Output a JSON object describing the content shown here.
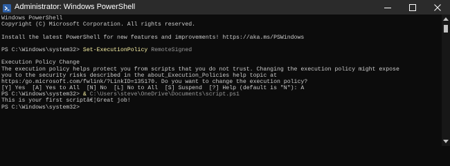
{
  "titlebar": {
    "title": "Administrator: Windows PowerShell",
    "app_icon": "powershell-icon",
    "controls": {
      "minimize_icon": "minimize-icon",
      "maximize_icon": "maximize-icon",
      "close_icon": "close-icon"
    }
  },
  "colors": {
    "background": "#0c0c0c",
    "text": "#cccccc",
    "command": "#f9f1a5",
    "parameter": "#9a9a9a",
    "titlebar": "#2b2b2b"
  },
  "terminal": {
    "lines": [
      {
        "text": "Windows PowerShell"
      },
      {
        "text": "Copyright (C) Microsoft Corporation. All rights reserved."
      },
      {
        "text": ""
      },
      {
        "text": "Install the latest PowerShell for new features and improvements! https://aka.ms/PSWindows"
      },
      {
        "text": ""
      },
      {
        "prompt": "PS C:\\Windows\\system32> ",
        "command": "Set-ExecutionPolicy",
        "argument": " RemoteSigned"
      },
      {
        "text": ""
      },
      {
        "text": "Execution Policy Change"
      },
      {
        "text": "The execution policy helps protect you from scripts that you do not trust. Changing the execution policy might expose"
      },
      {
        "text": "you to the security risks described in the about_Execution_Policies help topic at"
      },
      {
        "text": "https:/go.microsoft.com/fwlink/?LinkID=135170. Do you want to change the execution policy?"
      },
      {
        "text": "[Y] Yes  [A] Yes to All  [N] No  [L] No to All  [S] Suspend  [?] Help (default is \"N\"): A"
      },
      {
        "prompt": "PS C:\\Windows\\system32> ",
        "command": "&",
        "argument": " C:\\Users\\steve\\OneDrive\\Documents\\script.ps1"
      },
      {
        "text": "This is your first scriptâ€¦Great job!"
      },
      {
        "text": "PS C:\\Windows\\system32>"
      }
    ]
  },
  "scrollbar": {
    "up_icon": "scroll-up-arrow-icon",
    "down_icon": "scroll-down-arrow-icon"
  }
}
